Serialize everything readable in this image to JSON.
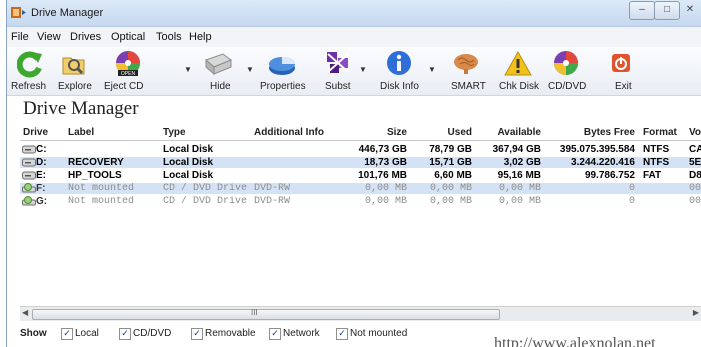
{
  "window": {
    "title": "Drive Manager"
  },
  "menu": [
    "File",
    "View",
    "Drives",
    "Optical",
    "Tools",
    "Help"
  ],
  "toolbar": [
    {
      "label": "Refresh",
      "icon": "refresh-icon"
    },
    {
      "label": "Explore",
      "icon": "explore-folder-icon"
    },
    {
      "label": "Eject CD",
      "icon": "eject-cd-icon"
    },
    {
      "label": "Hide",
      "icon": "hide-drive-icon"
    },
    {
      "label": "Properties",
      "icon": "properties-pie-icon"
    },
    {
      "label": "Subst",
      "icon": "subst-icon"
    },
    {
      "label": "Disk Info",
      "icon": "info-icon"
    },
    {
      "label": "SMART",
      "icon": "smart-brain-icon"
    },
    {
      "label": "Chk Disk",
      "icon": "warning-icon"
    },
    {
      "label": "CD/DVD",
      "icon": "cd-dvd-icon"
    },
    {
      "label": "Exit",
      "icon": "exit-power-icon"
    }
  ],
  "cd_badge": "OPEN",
  "page_title": "Drive Manager",
  "columns": [
    "Drive",
    "Label",
    "Type",
    "Additional Info",
    "Size",
    "Used",
    "Available",
    "Bytes Free",
    "Format",
    "Vo"
  ],
  "rows": [
    {
      "drive": "C:",
      "label": "",
      "type": "Local Disk",
      "info": "",
      "size": "446,73 GB",
      "used": "78,79 GB",
      "available": "367,94 GB",
      "bytes_free": "395.075.395.584",
      "format": "NTFS",
      "vol": "CA",
      "mounted": true
    },
    {
      "drive": "D:",
      "label": "RECOVERY",
      "type": "Local Disk",
      "info": "",
      "size": "18,73 GB",
      "used": "15,71 GB",
      "available": "3,02 GB",
      "bytes_free": "3.244.220.416",
      "format": "NTFS",
      "vol": "5E",
      "mounted": true
    },
    {
      "drive": "E:",
      "label": "HP_TOOLS",
      "type": "Local Disk",
      "info": "",
      "size": "101,76 MB",
      "used": "6,60 MB",
      "available": "95,16 MB",
      "bytes_free": "99.786.752",
      "format": "FAT",
      "vol": "D8",
      "mounted": true
    },
    {
      "drive": "F:",
      "label": "Not mounted",
      "type": "CD / DVD Drive",
      "info": "DVD-RW",
      "size": "0,00 MB",
      "used": "0,00 MB",
      "available": "0,00 MB",
      "bytes_free": "0",
      "format": "",
      "vol": "00",
      "mounted": false
    },
    {
      "drive": "G:",
      "label": "Not mounted",
      "type": "CD / DVD Drive",
      "info": "DVD-RW",
      "size": "0,00 MB",
      "used": "0,00 MB",
      "available": "0,00 MB",
      "bytes_free": "0",
      "format": "",
      "vol": "00",
      "mounted": false
    }
  ],
  "scroll_grip": "III",
  "status": {
    "show_label": "Show",
    "filters": [
      {
        "label": "Local",
        "checked": true
      },
      {
        "label": "CD/DVD",
        "checked": true
      },
      {
        "label": "Removable",
        "checked": true
      },
      {
        "label": "Network",
        "checked": true
      },
      {
        "label": "Not mounted",
        "checked": true
      }
    ]
  },
  "watermark": "http://www.alexnolan.net"
}
